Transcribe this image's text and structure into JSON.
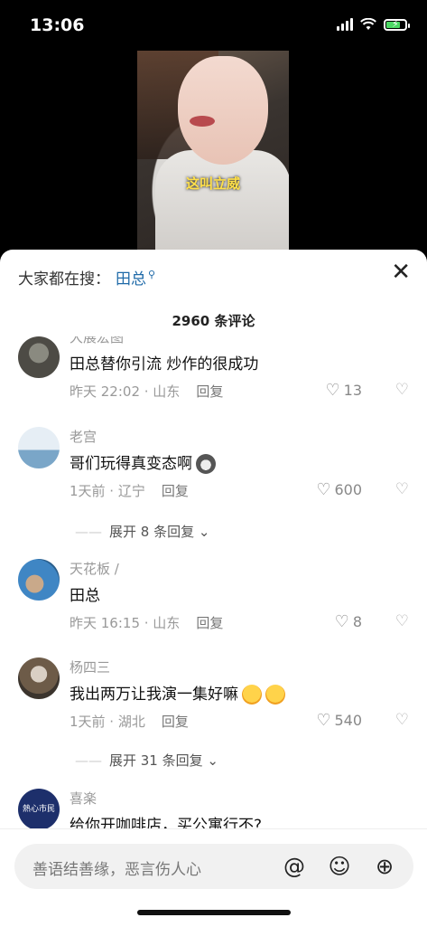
{
  "status_bar": {
    "time": "13:06"
  },
  "video": {
    "caption": "这叫立威"
  },
  "sheet": {
    "search_prefix": "大家都在搜：",
    "search_term": "田总",
    "search_icon": "search-icon",
    "comment_count": "2960 条评论"
  },
  "comments": [
    {
      "user": "大展宏图",
      "text": "田总替你引流 炒作的很成功",
      "time_loc": "昨天 22:02 · 山东",
      "reply": "回复",
      "likes": "13"
    },
    {
      "user": "老宫",
      "text": "哥们玩得真变态啊",
      "time_loc": "1天前 · 辽宁",
      "reply": "回复",
      "likes": "600"
    },
    {
      "expand": "展开 8 条回复"
    },
    {
      "user": "天花板 /",
      "text": "田总",
      "time_loc": "昨天 16:15 · 山东",
      "reply": "回复",
      "likes": "8"
    },
    {
      "user": "杨四三",
      "text": "我出两万让我演一集好嘛",
      "time_loc": "1天前 · 湖北",
      "reply": "回复",
      "likes": "540"
    },
    {
      "expand": "展开 31 条回复"
    },
    {
      "user": "喜楽",
      "text": "给你开咖啡店，买公寓行不?",
      "avatar_text": "熱心市民"
    }
  ],
  "bottom": {
    "input_placeholder": "善语结善缘，恶言伤人心"
  },
  "colors": {
    "link": "#1f6aa8",
    "caption": "#ffe04a"
  }
}
